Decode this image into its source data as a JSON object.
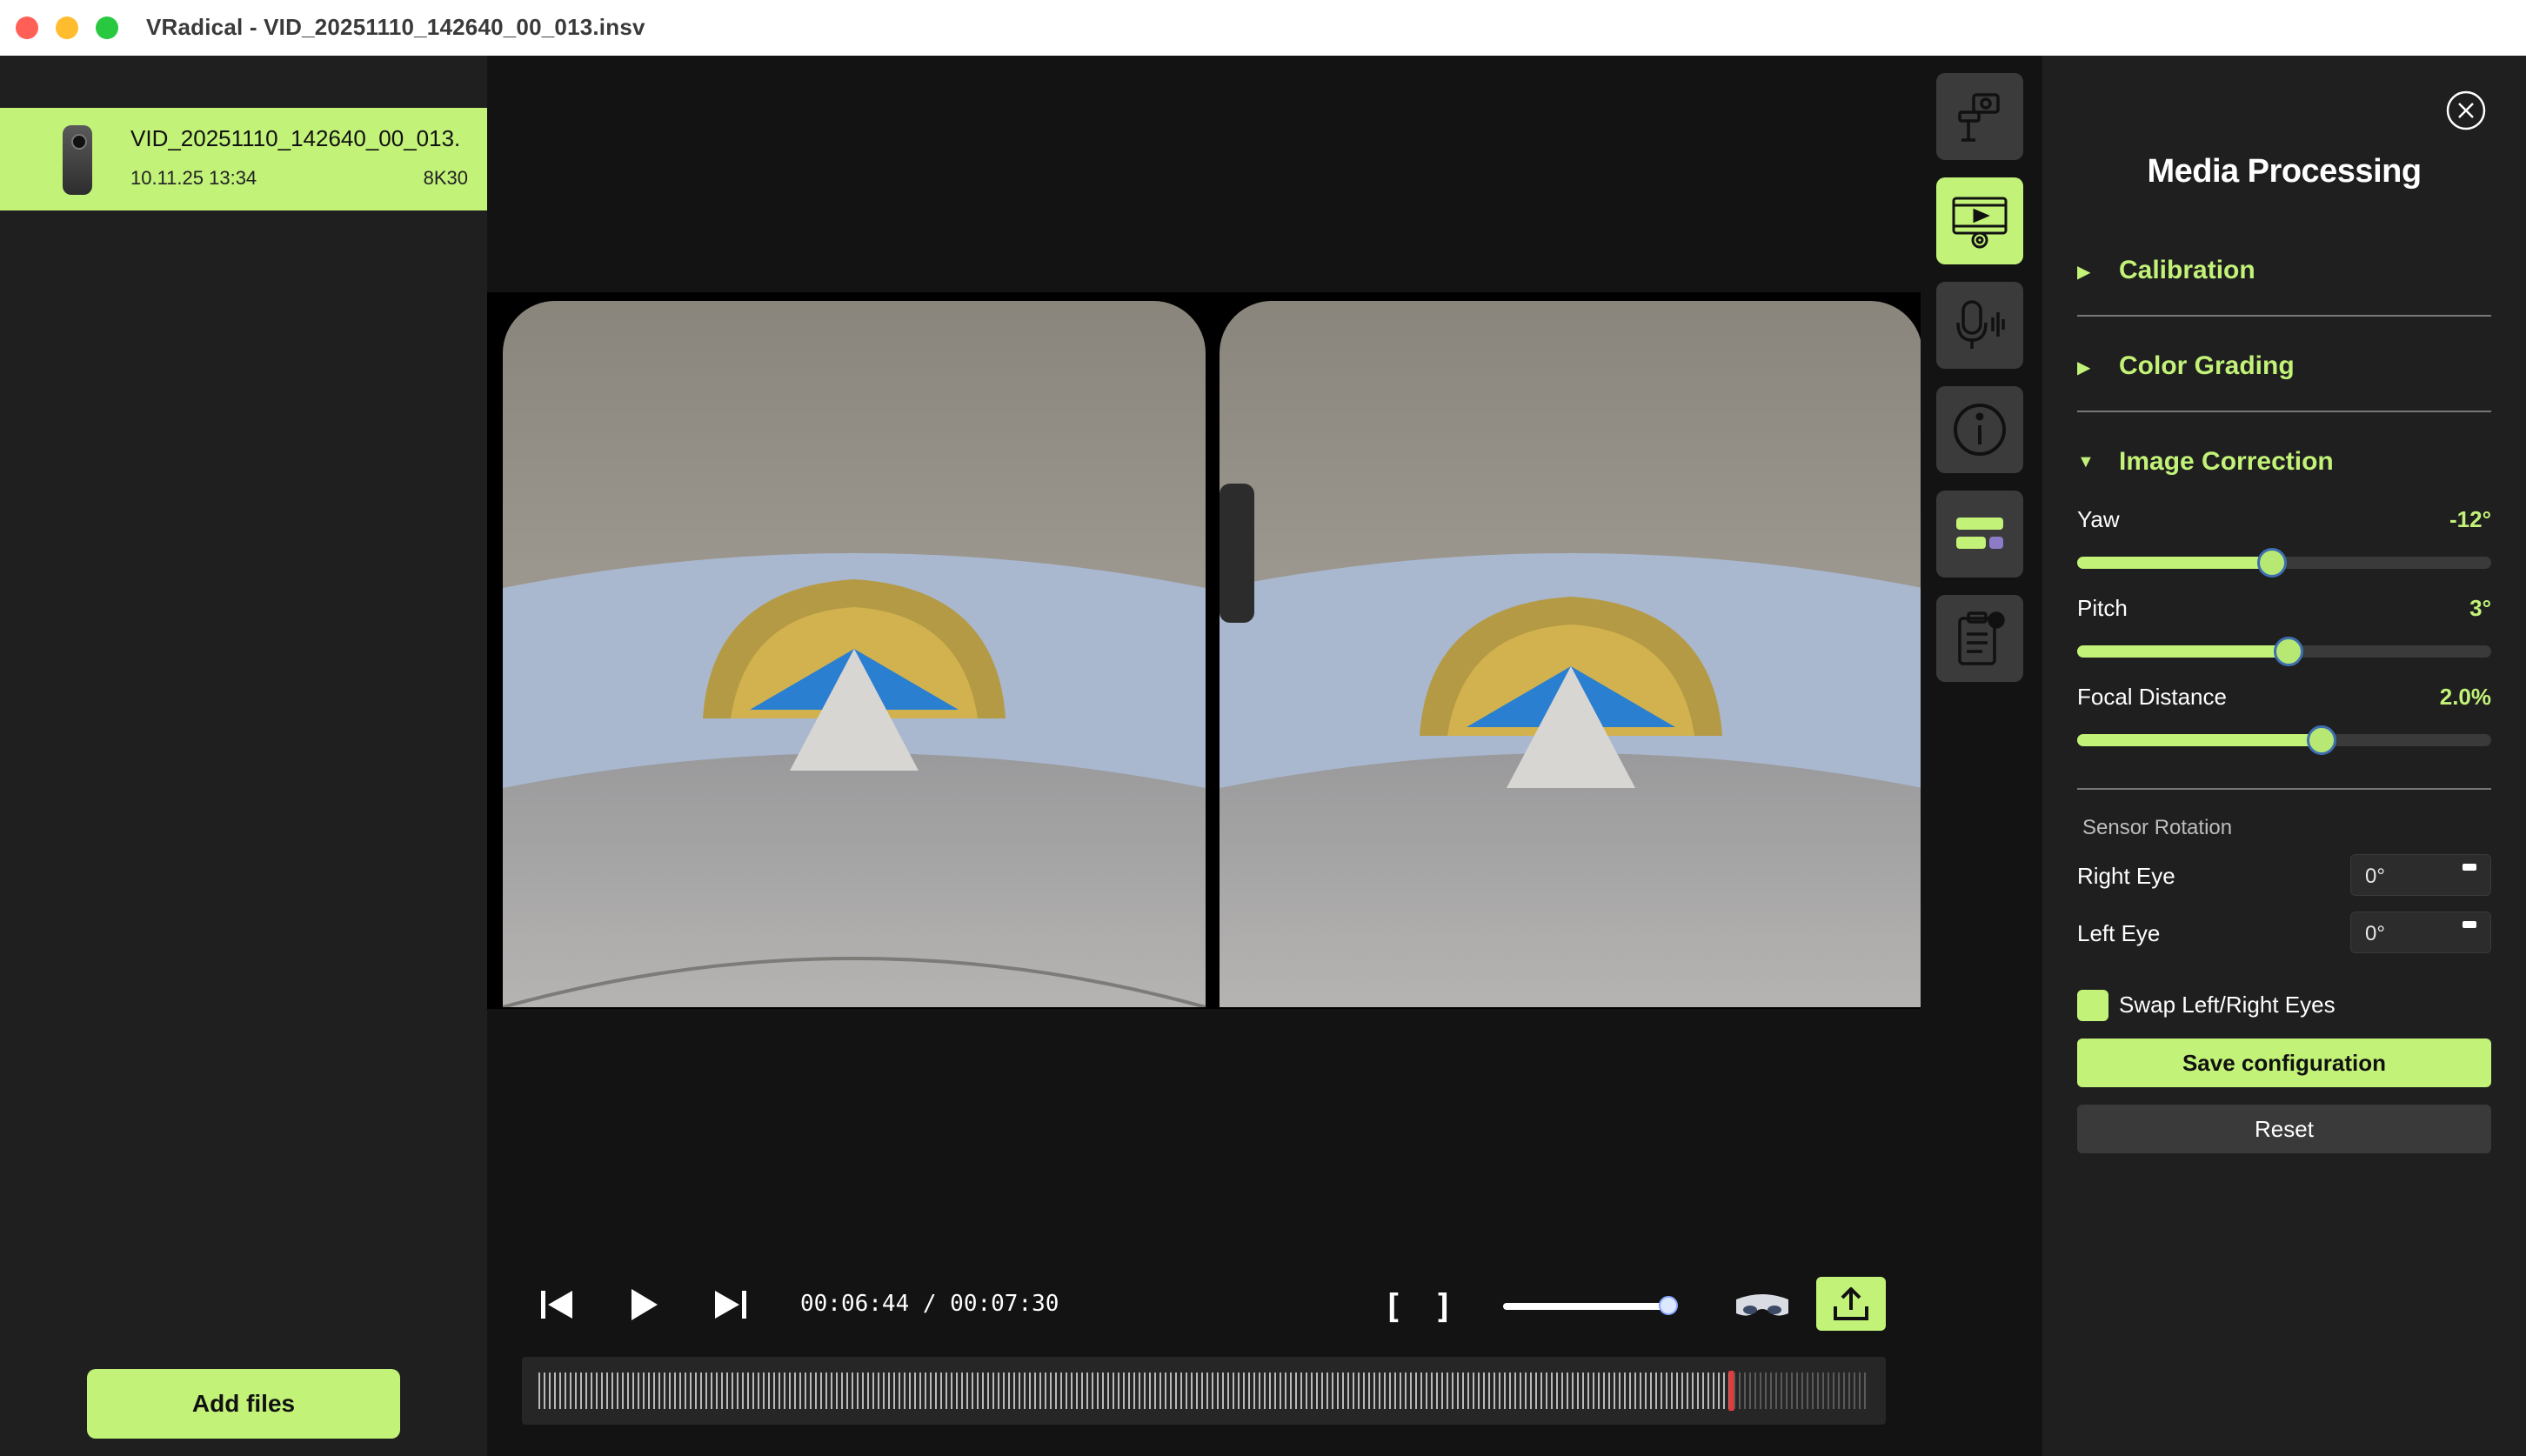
{
  "window": {
    "title": "VRadical - VID_20251110_142640_00_013.insv"
  },
  "sidebar": {
    "files": [
      {
        "name": "VID_20251110_142640_00_013.",
        "date": "10.11.25 13:34",
        "resolution": "8K30",
        "icon": "camera-icon"
      }
    ],
    "add_files_label": "Add files"
  },
  "player": {
    "timecode": "00:06:44 / 00:07:30",
    "mark_in": "[",
    "mark_out": "]",
    "volume": 1.0,
    "playhead_fraction": 0.897,
    "colors": {
      "accent": "#c2f278",
      "playhead": "#e23b3b"
    },
    "icons": [
      "skip-back-icon",
      "play-icon",
      "skip-forward-icon",
      "vr-headset-icon",
      "export-icon"
    ]
  },
  "toolstrip": {
    "tools": [
      {
        "name": "camera-tool",
        "icon": "camera-rig-icon",
        "active": false
      },
      {
        "name": "media-processing-tool",
        "icon": "film-gear-icon",
        "active": true
      },
      {
        "name": "audio-tool",
        "icon": "microphone-icon",
        "active": false
      },
      {
        "name": "info-tool",
        "icon": "info-icon",
        "active": false
      },
      {
        "name": "layout-tool",
        "icon": "layout-bars-icon",
        "active": false
      },
      {
        "name": "clipboard-tool",
        "icon": "clipboard-icon",
        "active": false
      }
    ]
  },
  "panel": {
    "title": "Media Processing",
    "sections": [
      {
        "label": "Calibration",
        "expanded": false
      },
      {
        "label": "Color Grading",
        "expanded": false
      },
      {
        "label": "Image Correction",
        "expanded": true
      }
    ],
    "sliders": [
      {
        "label": "Yaw",
        "value": "-12°",
        "fraction": 0.47
      },
      {
        "label": "Pitch",
        "value": "3°",
        "fraction": 0.51
      },
      {
        "label": "Focal Distance",
        "value": "2.0%",
        "fraction": 0.59
      }
    ],
    "sensor_rotation": {
      "heading": "Sensor Rotation",
      "right_eye": {
        "label": "Right Eye",
        "value": "0°"
      },
      "left_eye": {
        "label": "Left Eye",
        "value": "0°"
      }
    },
    "swap_eyes": {
      "label": "Swap Left/Right Eyes",
      "checked": true
    },
    "save_label": "Save configuration",
    "reset_label": "Reset"
  }
}
